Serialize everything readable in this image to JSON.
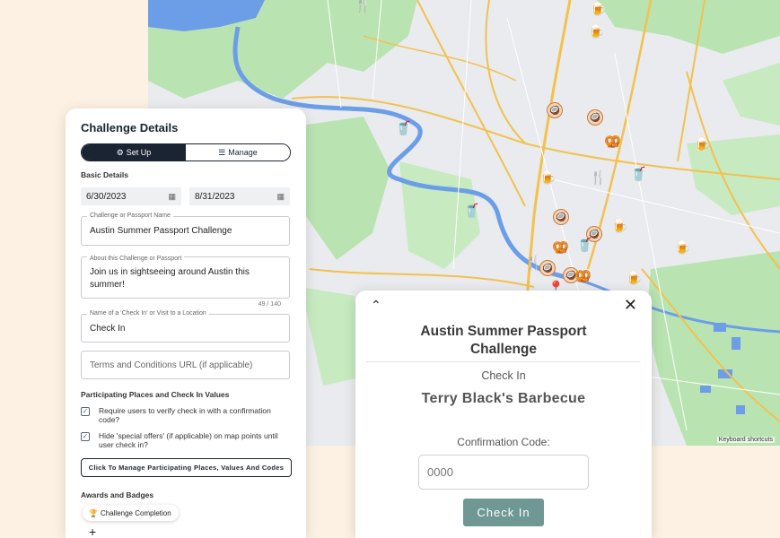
{
  "map": {
    "keyboard_shortcuts": "Keyboard shortcuts",
    "colors": {
      "land": "#e9ebee",
      "park": "#b9e4b1",
      "water": "#6c9ee8",
      "highway": "#f2c14e"
    }
  },
  "panel": {
    "title": "Challenge Details",
    "tabs": [
      {
        "label": "Set Up",
        "icon": "gear-icon",
        "active": true
      },
      {
        "label": "Manage",
        "icon": "list-icon",
        "active": false
      }
    ],
    "basic_details_label": "Basic Details",
    "start_date": "6/30/2023",
    "end_date": "8/31/2023",
    "name_field": {
      "label": "Challenge or Passport Name",
      "value": "Austin Summer Passport Challenge"
    },
    "about_field": {
      "label": "About this Challenge or Passport",
      "value": "Join us in sightseeing around Austin this summer!",
      "counter": "49 / 140"
    },
    "checkin_field": {
      "label": "Name of a 'Check In' or Visit to a Location",
      "value": "Check In"
    },
    "terms_field": {
      "placeholder": "Terms and Conditions URL (if applicable)"
    },
    "places_label": "Participating Places and Check In Values",
    "checkbox_1": "Require users to verify check in with a confirmation code?",
    "checkbox_2": "Hide 'special offers' (if applicable) on map points until user check in?",
    "manage_button": "Click To Manage Participating Places, Values And Codes",
    "awards_label": "Awards and Badges",
    "badge": "Challenge Completion",
    "add": "+"
  },
  "modal": {
    "title": "Austin Summer Passport Challenge",
    "checkin_label": "Check In",
    "place_name": "Terry Black's Barbecue",
    "code_label": "Confirmation Code:",
    "code_placeholder": "0000",
    "checkin_button": "Check In",
    "accent_color": "#6f9894"
  }
}
